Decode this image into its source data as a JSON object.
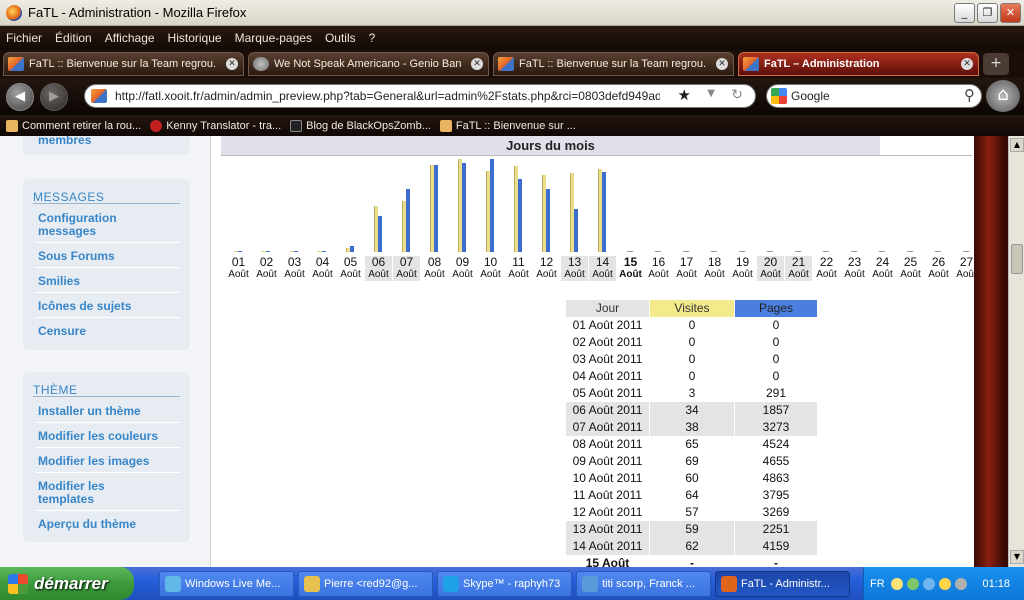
{
  "window": {
    "title": "FaTL - Administration - Mozilla Firefox"
  },
  "menu": [
    "Fichier",
    "Édition",
    "Affichage",
    "Historique",
    "Marque-pages",
    "Outils",
    "?"
  ],
  "tabs": [
    {
      "label": "FaTL :: Bienvenue sur la Team regrou...",
      "active": false
    },
    {
      "label": "We Not Speak Americano - Genio Ban...",
      "active": false
    },
    {
      "label": "FaTL :: Bienvenue sur la Team regrou...",
      "active": false
    },
    {
      "label": "FaTL – Administration",
      "active": true
    }
  ],
  "nav": {
    "url": "http://fatl.xooit.fr/admin/admin_preview.php?tab=General&url=admin%2Fstats.php&rci=0803defd949adf6e3d",
    "search_engine": "Google"
  },
  "bookmarks": [
    "Comment retirer la rou...",
    "Kenny Translator - tra...",
    "Blog de BlackOpsZomb...",
    "FaTL :: Bienvenue sur ..."
  ],
  "sidebar": {
    "top_partial": "membres",
    "messages": {
      "title": "MESSAGES",
      "items": [
        "Configuration messages",
        "Sous Forums",
        "Smilies",
        "Icônes de sujets",
        "Censure"
      ]
    },
    "theme": {
      "title": "THÈME",
      "items": [
        "Installer un thème",
        "Modifier les couleurs",
        "Modifier les images",
        "Modifier les templates",
        "Aperçu du thème"
      ]
    }
  },
  "chart_data": {
    "type": "bar",
    "title": "Jours du mois",
    "categories": [
      "01",
      "02",
      "03",
      "04",
      "05",
      "06",
      "07",
      "08",
      "09",
      "10",
      "11",
      "12",
      "13",
      "14",
      "15",
      "16",
      "17",
      "18",
      "19",
      "20",
      "21",
      "22",
      "23",
      "24",
      "25",
      "26",
      "27"
    ],
    "month_label": "Août",
    "series": [
      {
        "name": "Visites",
        "color": "#e8de8c",
        "values": [
          0,
          0,
          0,
          0,
          3,
          34,
          38,
          65,
          69,
          60,
          64,
          57,
          59,
          62,
          null,
          null,
          null,
          null,
          null,
          null,
          null,
          null,
          null,
          null,
          null,
          null,
          null
        ]
      },
      {
        "name": "Pages",
        "color": "#3c6ed0",
        "values": [
          0,
          0,
          0,
          0,
          291,
          1857,
          3273,
          4524,
          4655,
          4863,
          3795,
          3269,
          2251,
          4159,
          null,
          null,
          null,
          null,
          null,
          null,
          null,
          null,
          null,
          null,
          null,
          null,
          null
        ]
      }
    ],
    "current_day": "15"
  },
  "stats": {
    "headers": [
      "Jour",
      "Visites",
      "Pages"
    ],
    "rows": [
      [
        "01 Août 2011",
        "0",
        "0"
      ],
      [
        "02 Août 2011",
        "0",
        "0"
      ],
      [
        "03 Août 2011",
        "0",
        "0"
      ],
      [
        "04 Août 2011",
        "0",
        "0"
      ],
      [
        "05 Août 2011",
        "3",
        "291"
      ],
      [
        "06 Août 2011",
        "34",
        "1857"
      ],
      [
        "07 Août 2011",
        "38",
        "3273"
      ],
      [
        "08 Août 2011",
        "65",
        "4524"
      ],
      [
        "09 Août 2011",
        "69",
        "4655"
      ],
      [
        "10 Août 2011",
        "60",
        "4863"
      ],
      [
        "11 Août 2011",
        "64",
        "3795"
      ],
      [
        "12 Août 2011",
        "57",
        "3269"
      ],
      [
        "13 Août 2011",
        "59",
        "2251"
      ],
      [
        "14 Août 2011",
        "62",
        "4159"
      ],
      [
        "15 Août",
        "-",
        "-"
      ]
    ]
  },
  "taskbar": {
    "start": "démarrer",
    "tasks": [
      "Windows Live Me...",
      "Pierre <red92@g...",
      "Skype™ - raphyh73",
      "titi scorp, Franck ...",
      "FaTL - Administr..."
    ],
    "lang": "FR",
    "clock": "01:18"
  }
}
